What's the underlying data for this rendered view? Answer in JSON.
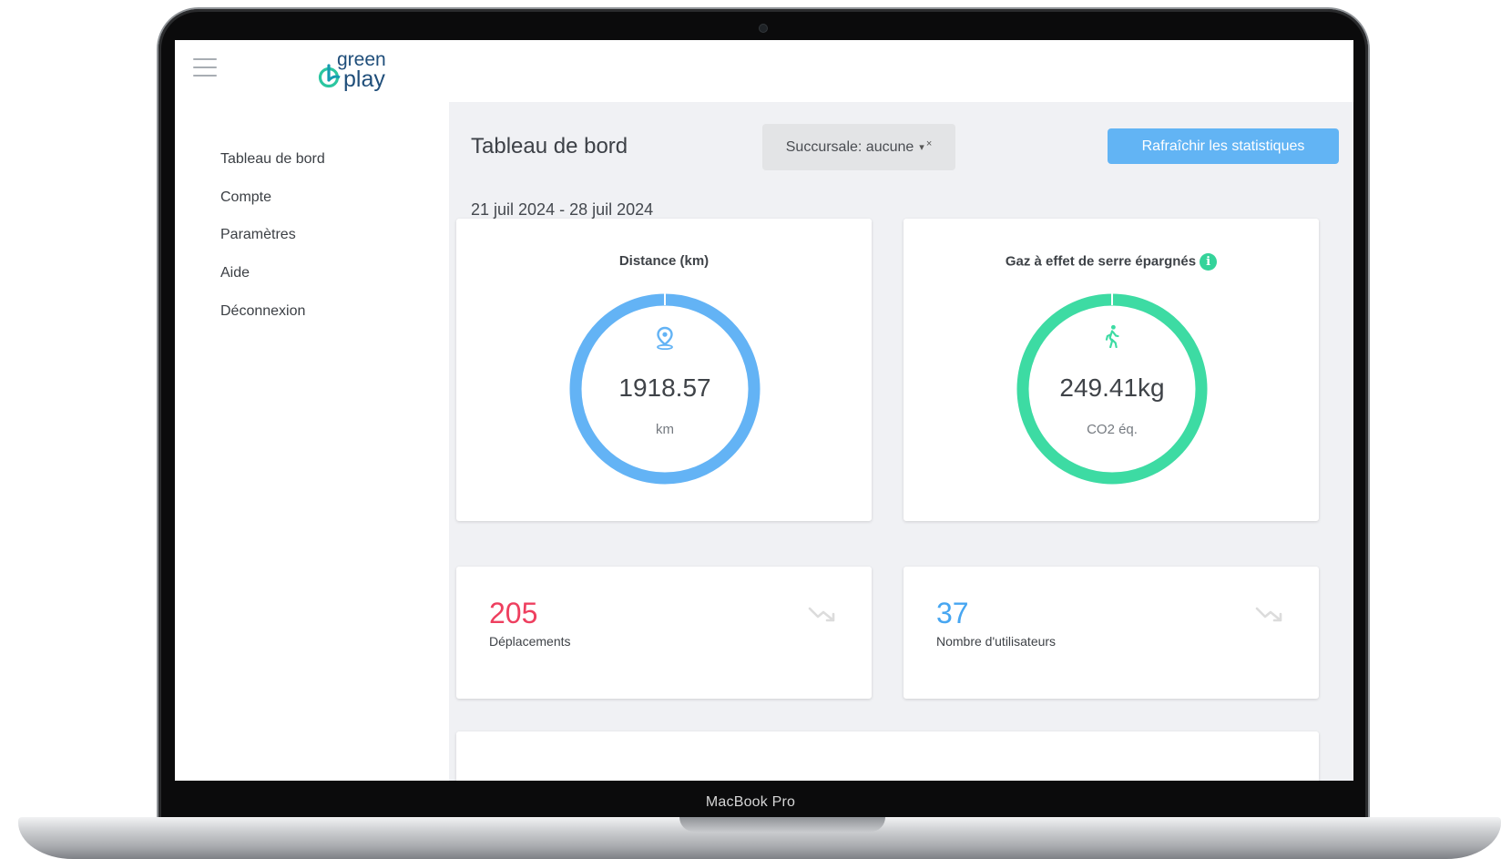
{
  "device": {
    "bezel_label": "MacBook Pro"
  },
  "header": {
    "menu_icon": "hamburger-menu-icon",
    "logo": {
      "line1": "green",
      "line2": "play",
      "icon": "green-play-logo-mark"
    }
  },
  "sidebar": {
    "items": [
      {
        "label": "Tableau de bord"
      },
      {
        "label": "Compte"
      },
      {
        "label": "Paramètres"
      },
      {
        "label": "Aide"
      },
      {
        "label": "Déconnexion"
      }
    ]
  },
  "main": {
    "title": "Tableau de bord",
    "branch_select": {
      "value": "Succursale: aucune",
      "caret": "▾",
      "clear": "×"
    },
    "refresh_label": "Rafraîchir les statistiques",
    "date_range": "21 juil 2024 - 28 juil 2024",
    "cards": {
      "distance": {
        "title": "Distance (km)",
        "value": "1918.57",
        "unit": "km",
        "icon": "location-pin-icon",
        "color": "#63b3f5"
      },
      "ghg": {
        "title": "Gaz à effet de serre épargnés",
        "info_glyph": "i",
        "value": "249.41kg",
        "unit": "CO2 éq.",
        "icon": "walking-person-icon",
        "color": "#3ddba3"
      }
    },
    "stats": {
      "trips": {
        "value": "205",
        "label": "Déplacements",
        "color": "#ee3f5f",
        "trend_icon": "trending-down-icon"
      },
      "users": {
        "value": "37",
        "label": "Nombre d'utilisateurs",
        "color": "#47a6f1",
        "trend_icon": "trending-down-icon"
      }
    }
  }
}
